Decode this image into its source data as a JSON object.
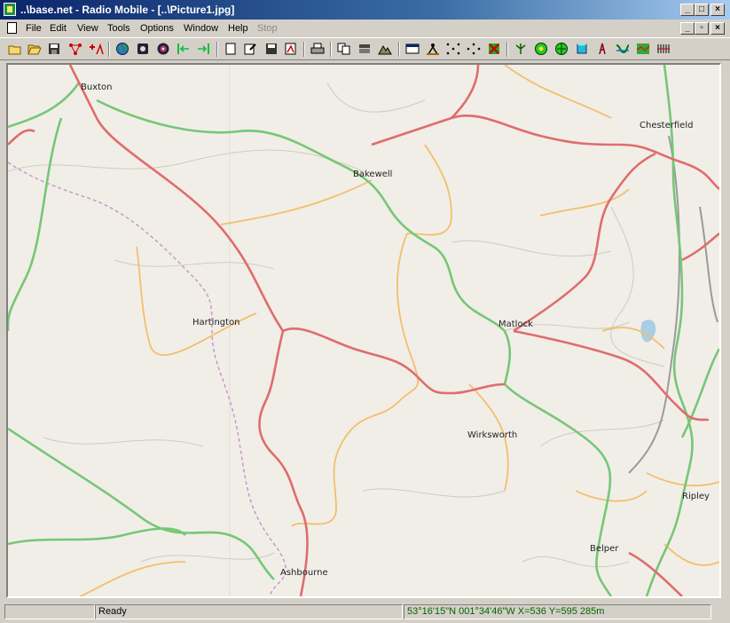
{
  "window": {
    "title": "..\\base.net - Radio Mobile - [..\\Picture1.jpg]"
  },
  "menu": [
    {
      "label": "File"
    },
    {
      "label": "Edit"
    },
    {
      "label": "View"
    },
    {
      "label": "Tools"
    },
    {
      "label": "Options"
    },
    {
      "label": "Window"
    },
    {
      "label": "Help"
    },
    {
      "label": "Stop",
      "disabled": true
    }
  ],
  "toolbar": {
    "icons": [
      "new-folder-icon",
      "open-folder-icon",
      "save-icon",
      "network-properties-icon",
      "add-unit-icon",
      "globe-icon",
      "disk-icon",
      "target-icon",
      "move-left-icon",
      "move-right-icon",
      "blank-page-icon",
      "edit-page-icon",
      "save-page-icon",
      "picture-icon",
      "print-icon",
      "copy-icon",
      "stack-icon",
      "terrain-icon",
      "window-icon",
      "person-icon",
      "dots-square-icon",
      "dots-cross-icon",
      "cancel-icon",
      "antenna-icon",
      "green-target-icon",
      "green-globe-icon",
      "cylinder-icon",
      "tower-icon",
      "road-icon",
      "map-tile-icon",
      "bars-icon"
    ]
  },
  "map": {
    "towns": [
      {
        "name": "Buxton"
      },
      {
        "name": "Bakewell"
      },
      {
        "name": "Chesterfield"
      },
      {
        "name": "Hartington"
      },
      {
        "name": "Matlock"
      },
      {
        "name": "Wirksworth"
      },
      {
        "name": "Ripley"
      },
      {
        "name": "Belper"
      },
      {
        "name": "Ashbourne"
      }
    ],
    "colors": {
      "background": "#f1eee8",
      "primary_road": "#e06c6c",
      "secondary_road": "#76c776",
      "minor_road": "#f3bf6a",
      "boundary": "#c79ac7",
      "water": "#a9cde6"
    }
  },
  "status": {
    "left": "",
    "message": "Ready",
    "coords": "53°16'15\"N 001°34'46\"W  X=536 Y=595 285m"
  }
}
